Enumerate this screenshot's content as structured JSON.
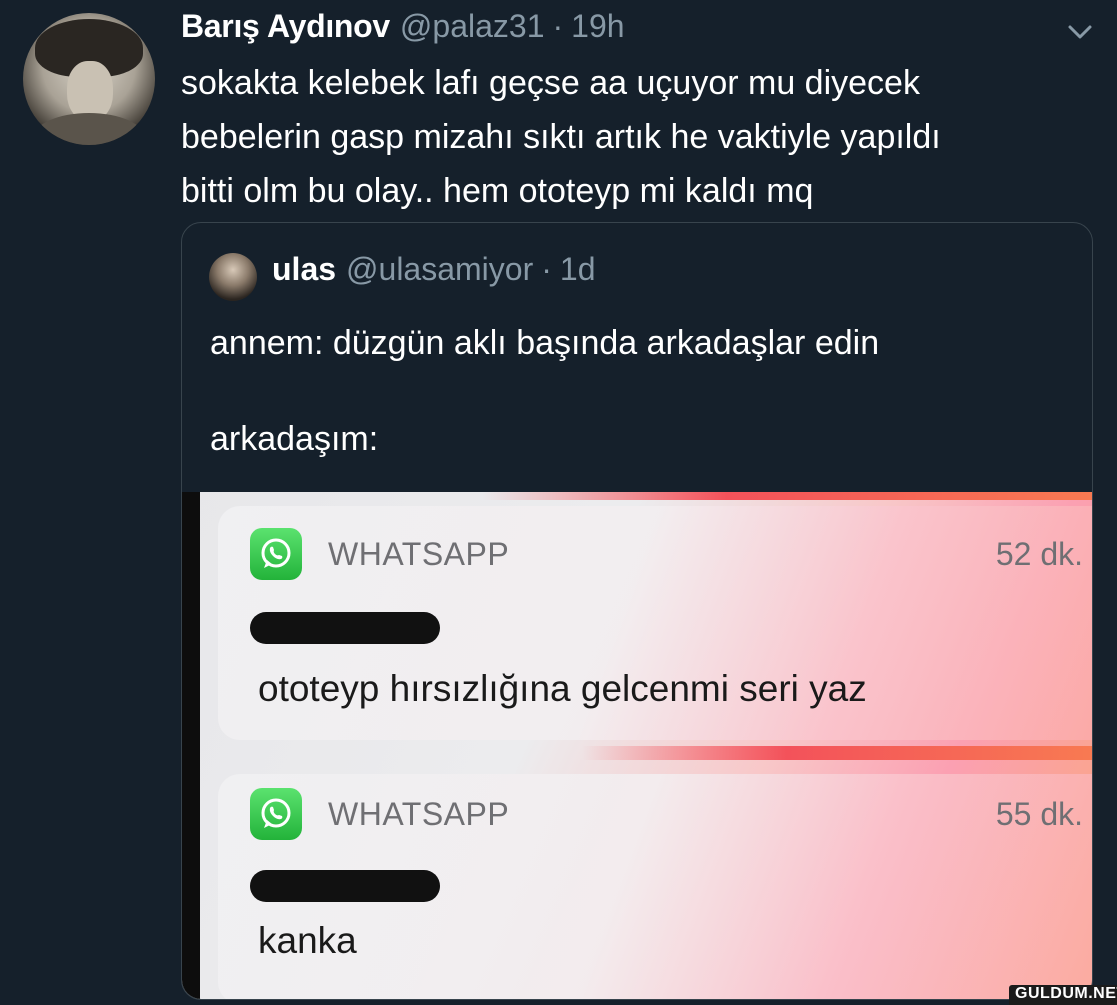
{
  "tweet": {
    "author_name": "Barış Aydınov",
    "author_handle": "@palaz31",
    "separator": "·",
    "time": "19h",
    "text": "sokakta kelebek lafı geçse aa uçuyor mu diyecek\nbebelerin gasp mizahı sıktı artık he vaktiyle yapıldı\nbitti olm bu olay.. hem ototeyp mi kaldı mq"
  },
  "quote": {
    "author_name": "ulas",
    "author_handle": "@ulasamiyor",
    "separator": "·",
    "time": "1d",
    "line1": "annem: düzgün aklı başında arkadaşlar edin",
    "line2": "arkadaşım:"
  },
  "notifications": [
    {
      "app": "WHATSAPP",
      "time": "52 dk.",
      "message": "ototeyp hırsızlığına gelcenmi seri yaz"
    },
    {
      "app": "WHATSAPP",
      "time": "55 dk.",
      "message": "kanka"
    }
  ],
  "watermark": "GULDUM.NET",
  "colors": {
    "background": "#15202b",
    "secondary_text": "#8899a6",
    "border": "#38444d",
    "whatsapp_green": "#25d366"
  },
  "icons": {
    "menu": "chevron-down-icon",
    "app": "whatsapp-icon"
  }
}
